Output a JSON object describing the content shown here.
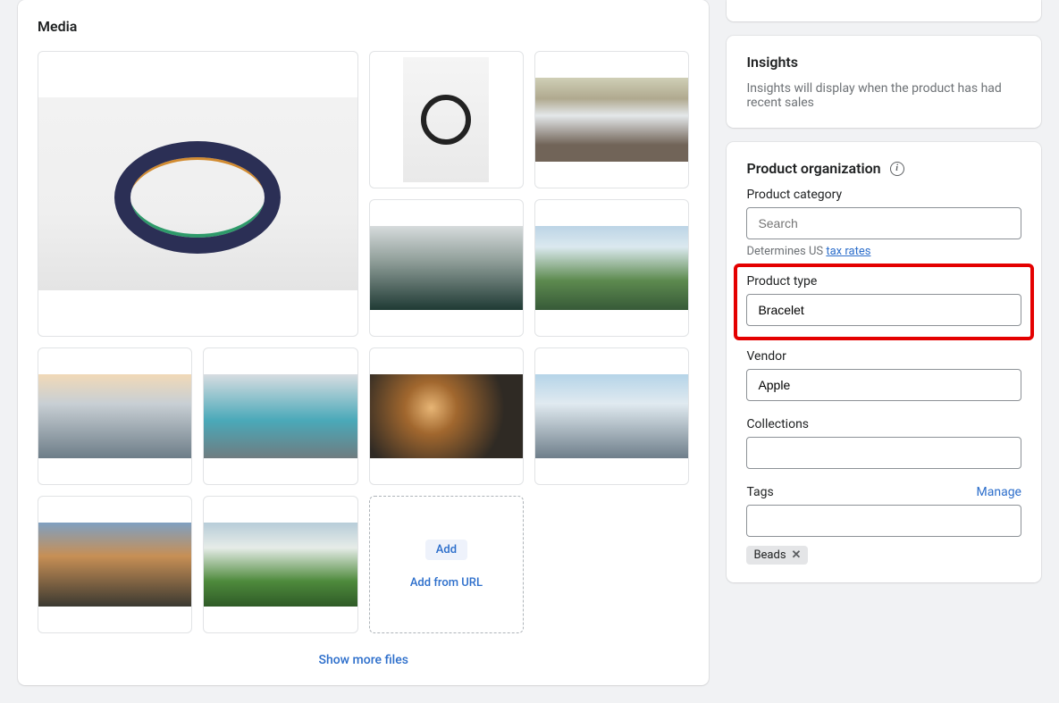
{
  "media": {
    "heading": "Media",
    "addLabel": "Add",
    "addUrlLabel": "Add from URL",
    "showMoreLabel": "Show more files"
  },
  "insights": {
    "heading": "Insights",
    "empty": "Insights will display when the product has had recent sales"
  },
  "organization": {
    "heading": "Product organization",
    "categoryLabel": "Product category",
    "categoryPlaceholder": "Search",
    "categoryHelpPrefix": "Determines US ",
    "categoryHelpLink": "tax rates",
    "typeLabel": "Product type",
    "typeValue": "Bracelet",
    "vendorLabel": "Vendor",
    "vendorValue": "Apple",
    "collectionsLabel": "Collections",
    "collectionsValue": "",
    "tagsLabel": "Tags",
    "manageLabel": "Manage",
    "tagsValue": "",
    "tagPill": "Beads"
  }
}
